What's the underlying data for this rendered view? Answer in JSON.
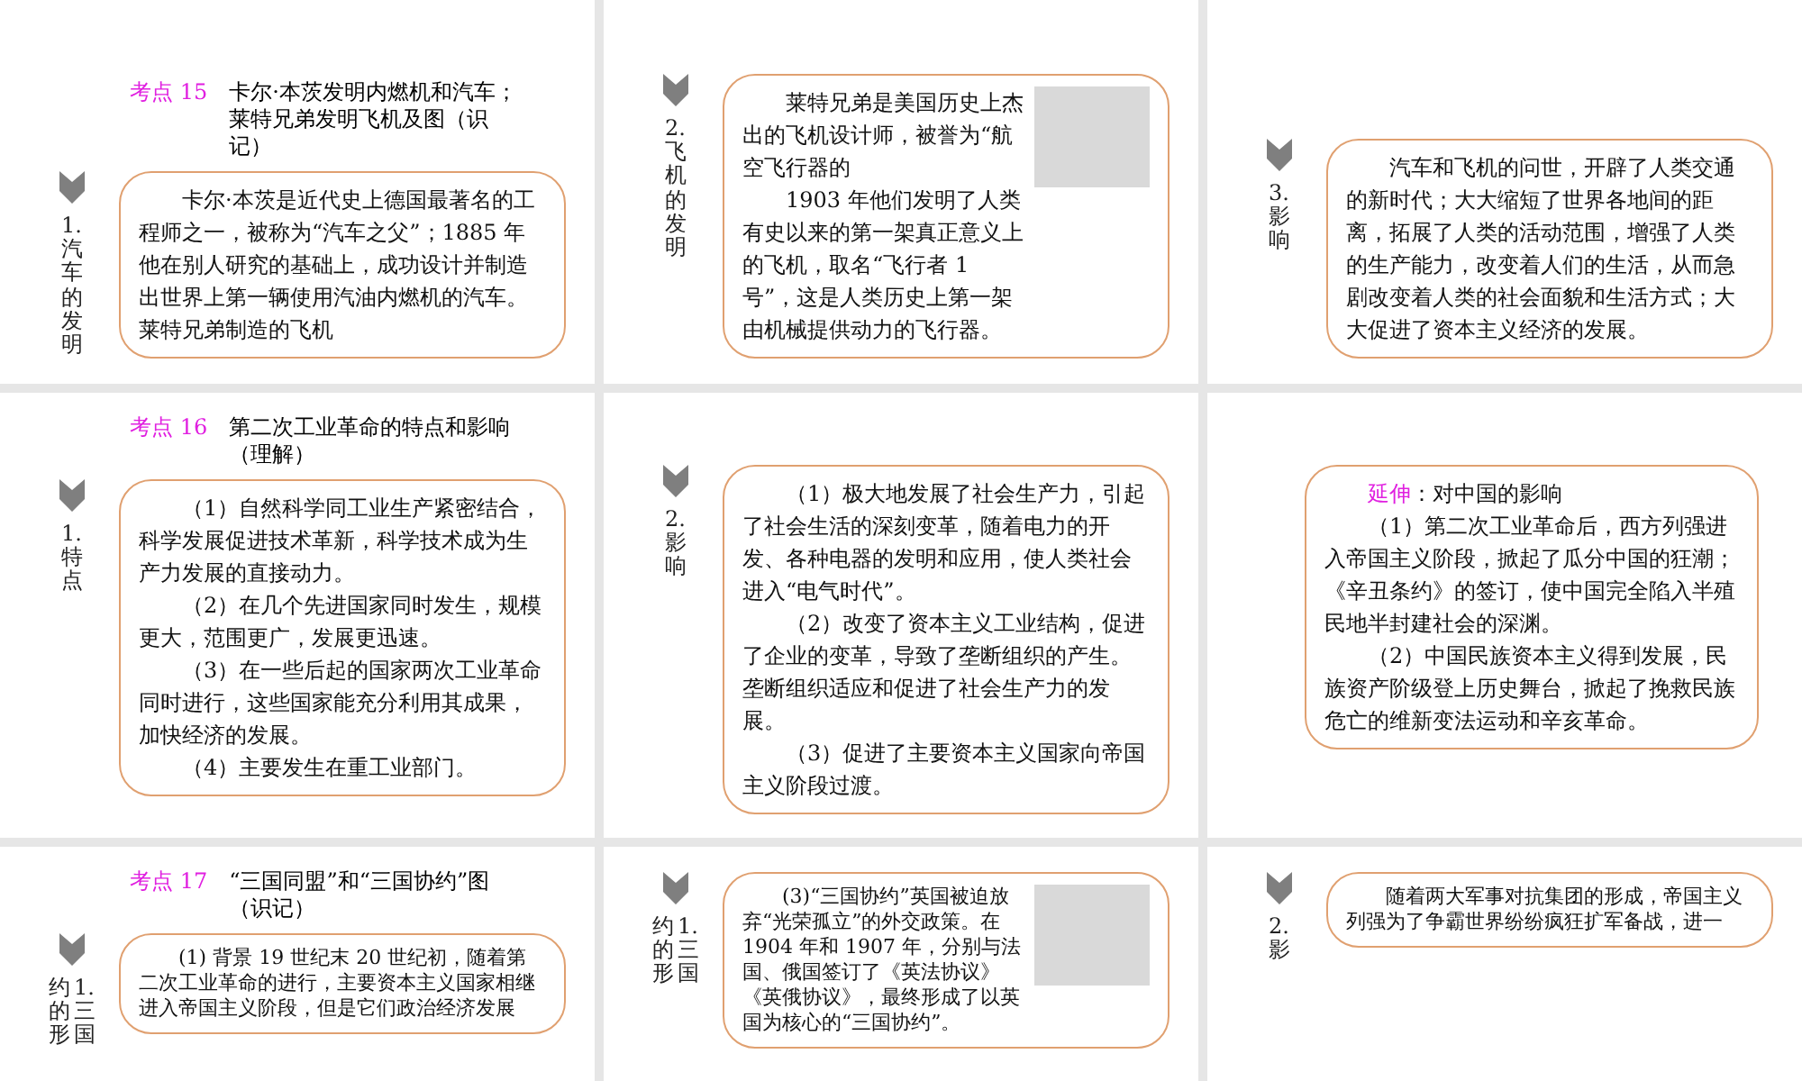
{
  "slides": [
    {
      "header": {
        "tag": "考点 15",
        "title": "卡尔·本茨发明内燃机和汽车；莱特兄弟发明飞机及图（识记）"
      },
      "side_label": [
        "1. 汽车的发明"
      ],
      "paragraphs": [
        "卡尔·本茨是近代史上德国最著名的工程师之一，被称为“汽车之父”；1885 年他在别人研究的基础上，成功设计并制造出世界上第一辆使用汽油内燃机的汽车。莱特兄弟制造的飞机"
      ]
    },
    {
      "side_label": [
        "2. 飞机的发明"
      ],
      "picture": true,
      "paragraphs": [
        "莱特兄弟是美国历史上杰出的飞机设计师，被誉为“航空飞行器的",
        "1903 年他们发明了人类有史以来的第一架真正意义上的飞机，取名“飞行者 1 号”，这是人类历史上第一架由机械提供动力的飞行器。"
      ]
    },
    {
      "side_label": [
        "3. 影响"
      ],
      "paragraphs": [
        "汽车和飞机的问世，开辟了人类交通的新时代；大大缩短了世界各地间的距离，拓展了人类的活动范围，增强了人类的生产能力，改变着人们的生活，从而急剧改变着人类的社会面貌和生活方式；大大促进了资本主义经济的发展。"
      ]
    },
    {
      "header": {
        "tag": "考点 16",
        "title": "第二次工业革命的特点和影响（理解）"
      },
      "side_label": [
        "1. 特点"
      ],
      "paragraphs": [
        "（1）自然科学同工业生产紧密结合，科学发展促进技术革新，科学技术成为生产力发展的直接动力。",
        "（2）在几个先进国家同时发生，规模更大，范围更广，发展更迅速。",
        "（3）在一些后起的国家两次工业革命同时进行，这些国家能充分利用其成果，加快经济的发展。",
        "（4）主要发生在重工业部门。"
      ]
    },
    {
      "side_label": [
        "2. 影响"
      ],
      "paragraphs": [
        "（1）极大地发展了社会生产力，引起了社会生活的深刻变革，随着电力的开发、各种电器的发明和应用，使人类社会进入“电气时代”。",
        "（2）改变了资本主义工业结构，促进了企业的变革，导致了垄断组织的产生。垄断组织适应和促进了社会生产力的发展。",
        "（3）促进了主要资本主义国家向帝国主义阶段过渡。"
      ]
    },
    {
      "lead": {
        "tag": "延伸",
        "text": "：对中国的影响"
      },
      "paragraphs": [
        "（1）第二次工业革命后，西方列强进入帝国主义阶段，掀起了瓜分中国的狂潮；《辛丑条约》的签订，使中国完全陷入半殖民地半封建社会的深渊。",
        "（2）中国民族资本主义得到发展，民族资产阶级登上历史舞台，掀起了挽救民族危亡的维新变法运动和辛亥革命。"
      ]
    },
    {
      "header": {
        "tag": "考点 17",
        "title": "“三国同盟”和“三国协约”图（识记）"
      },
      "side_label": [
        "约的形",
        "1. 三国"
      ],
      "paragraphs": [
        "(1) 背景 19 世纪末 20 世纪初，随着第二次工业革命的进行，主要资本主义国家相继进入帝国主义阶段，但是它们政治经济发展"
      ]
    },
    {
      "side_label": [
        "约的形",
        "1. 三国"
      ],
      "picture": true,
      "paragraphs": [
        "(3)“三国协约”英国被迫放弃“光荣孤立”的外交政策。在 1904 年和 1907 年，分别与法国、俄国签订了《英法协议》《英俄协议》，最终形成了以英国为核心的“三国协约”。"
      ]
    },
    {
      "side_label": [
        "2. 影"
      ],
      "paragraphs": [
        "随着两大军事对抗集团的形成，帝国主义列强为了争霸世界纷纷疯狂扩军备战，进一"
      ]
    }
  ]
}
